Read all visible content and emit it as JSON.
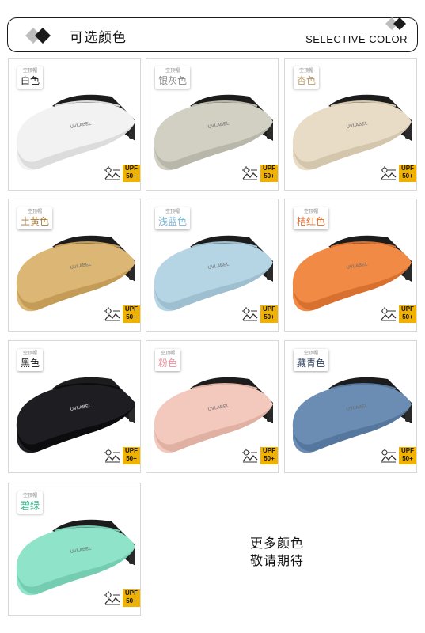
{
  "header": {
    "title": "可选颜色",
    "subtitle": "SELECTIVE COLOR"
  },
  "cards": [
    {
      "tag_small": "空顶帽",
      "name": "白色",
      "color": "#f2f2f2",
      "shade": "#dcdcdc",
      "name_color": "#111111",
      "logo": "UVLABEL"
    },
    {
      "tag_small": "空顶帽",
      "name": "银灰色",
      "color": "#d2cfc3",
      "shade": "#b9b6aa",
      "name_color": "#8a8a8a",
      "logo": "UVLABEL"
    },
    {
      "tag_small": "空顶帽",
      "name": "杏色",
      "color": "#e8dcc6",
      "shade": "#d3c6ad",
      "name_color": "#b79a6a",
      "logo": "UVLABEL"
    },
    {
      "tag_small": "空顶帽",
      "name": "土黄色",
      "color": "#dcb674",
      "shade": "#c49c58",
      "name_color": "#a2783a",
      "logo": "UVLABEL"
    },
    {
      "tag_small": "空顶帽",
      "name": "浅蓝色",
      "color": "#b6d5e4",
      "shade": "#9dbfd0",
      "name_color": "#7ab6d4",
      "logo": "UVLABEL"
    },
    {
      "tag_small": "空顶帽",
      "name": "桔红色",
      "color": "#f08a45",
      "shade": "#d8702f",
      "name_color": "#e06a28",
      "logo": "UVLABEL"
    },
    {
      "tag_small": "空顶帽",
      "name": "黑色",
      "color": "#1e1e22",
      "shade": "#0c0c0e",
      "name_color": "#111111",
      "logo": "UVLABEL"
    },
    {
      "tag_small": "空顶帽",
      "name": "粉色",
      "color": "#f3c9bd",
      "shade": "#e0b0a2",
      "name_color": "#ef8f9c",
      "logo": "UVLABEL"
    },
    {
      "tag_small": "空顶帽",
      "name": "藏青色",
      "color": "#6b8db4",
      "shade": "#56779d",
      "name_color": "#2c3e5c",
      "logo": "UVLABEL"
    },
    {
      "tag_small": "空顶帽",
      "name": "碧绿",
      "color": "#8fe3c8",
      "shade": "#74cdb0",
      "name_color": "#37b88c",
      "logo": "UVLABEL"
    }
  ],
  "upf_badge": {
    "line1": "UPF",
    "line2": "50+"
  },
  "more": {
    "line1": "更多颜色",
    "line2": "敬请期待"
  }
}
